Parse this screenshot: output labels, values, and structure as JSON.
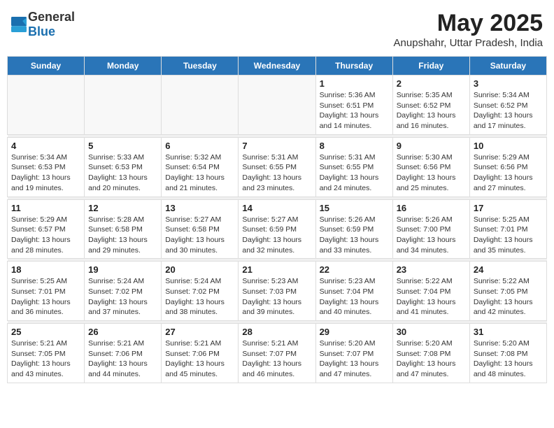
{
  "header": {
    "logo_general": "General",
    "logo_blue": "Blue",
    "month_year": "May 2025",
    "location": "Anupshahr, Uttar Pradesh, India"
  },
  "weekdays": [
    "Sunday",
    "Monday",
    "Tuesday",
    "Wednesday",
    "Thursday",
    "Friday",
    "Saturday"
  ],
  "weeks": [
    [
      {
        "day": "",
        "info": ""
      },
      {
        "day": "",
        "info": ""
      },
      {
        "day": "",
        "info": ""
      },
      {
        "day": "",
        "info": ""
      },
      {
        "day": "1",
        "info": "Sunrise: 5:36 AM\nSunset: 6:51 PM\nDaylight: 13 hours\nand 14 minutes."
      },
      {
        "day": "2",
        "info": "Sunrise: 5:35 AM\nSunset: 6:52 PM\nDaylight: 13 hours\nand 16 minutes."
      },
      {
        "day": "3",
        "info": "Sunrise: 5:34 AM\nSunset: 6:52 PM\nDaylight: 13 hours\nand 17 minutes."
      }
    ],
    [
      {
        "day": "4",
        "info": "Sunrise: 5:34 AM\nSunset: 6:53 PM\nDaylight: 13 hours\nand 19 minutes."
      },
      {
        "day": "5",
        "info": "Sunrise: 5:33 AM\nSunset: 6:53 PM\nDaylight: 13 hours\nand 20 minutes."
      },
      {
        "day": "6",
        "info": "Sunrise: 5:32 AM\nSunset: 6:54 PM\nDaylight: 13 hours\nand 21 minutes."
      },
      {
        "day": "7",
        "info": "Sunrise: 5:31 AM\nSunset: 6:55 PM\nDaylight: 13 hours\nand 23 minutes."
      },
      {
        "day": "8",
        "info": "Sunrise: 5:31 AM\nSunset: 6:55 PM\nDaylight: 13 hours\nand 24 minutes."
      },
      {
        "day": "9",
        "info": "Sunrise: 5:30 AM\nSunset: 6:56 PM\nDaylight: 13 hours\nand 25 minutes."
      },
      {
        "day": "10",
        "info": "Sunrise: 5:29 AM\nSunset: 6:56 PM\nDaylight: 13 hours\nand 27 minutes."
      }
    ],
    [
      {
        "day": "11",
        "info": "Sunrise: 5:29 AM\nSunset: 6:57 PM\nDaylight: 13 hours\nand 28 minutes."
      },
      {
        "day": "12",
        "info": "Sunrise: 5:28 AM\nSunset: 6:58 PM\nDaylight: 13 hours\nand 29 minutes."
      },
      {
        "day": "13",
        "info": "Sunrise: 5:27 AM\nSunset: 6:58 PM\nDaylight: 13 hours\nand 30 minutes."
      },
      {
        "day": "14",
        "info": "Sunrise: 5:27 AM\nSunset: 6:59 PM\nDaylight: 13 hours\nand 32 minutes."
      },
      {
        "day": "15",
        "info": "Sunrise: 5:26 AM\nSunset: 6:59 PM\nDaylight: 13 hours\nand 33 minutes."
      },
      {
        "day": "16",
        "info": "Sunrise: 5:26 AM\nSunset: 7:00 PM\nDaylight: 13 hours\nand 34 minutes."
      },
      {
        "day": "17",
        "info": "Sunrise: 5:25 AM\nSunset: 7:01 PM\nDaylight: 13 hours\nand 35 minutes."
      }
    ],
    [
      {
        "day": "18",
        "info": "Sunrise: 5:25 AM\nSunset: 7:01 PM\nDaylight: 13 hours\nand 36 minutes."
      },
      {
        "day": "19",
        "info": "Sunrise: 5:24 AM\nSunset: 7:02 PM\nDaylight: 13 hours\nand 37 minutes."
      },
      {
        "day": "20",
        "info": "Sunrise: 5:24 AM\nSunset: 7:02 PM\nDaylight: 13 hours\nand 38 minutes."
      },
      {
        "day": "21",
        "info": "Sunrise: 5:23 AM\nSunset: 7:03 PM\nDaylight: 13 hours\nand 39 minutes."
      },
      {
        "day": "22",
        "info": "Sunrise: 5:23 AM\nSunset: 7:04 PM\nDaylight: 13 hours\nand 40 minutes."
      },
      {
        "day": "23",
        "info": "Sunrise: 5:22 AM\nSunset: 7:04 PM\nDaylight: 13 hours\nand 41 minutes."
      },
      {
        "day": "24",
        "info": "Sunrise: 5:22 AM\nSunset: 7:05 PM\nDaylight: 13 hours\nand 42 minutes."
      }
    ],
    [
      {
        "day": "25",
        "info": "Sunrise: 5:21 AM\nSunset: 7:05 PM\nDaylight: 13 hours\nand 43 minutes."
      },
      {
        "day": "26",
        "info": "Sunrise: 5:21 AM\nSunset: 7:06 PM\nDaylight: 13 hours\nand 44 minutes."
      },
      {
        "day": "27",
        "info": "Sunrise: 5:21 AM\nSunset: 7:06 PM\nDaylight: 13 hours\nand 45 minutes."
      },
      {
        "day": "28",
        "info": "Sunrise: 5:21 AM\nSunset: 7:07 PM\nDaylight: 13 hours\nand 46 minutes."
      },
      {
        "day": "29",
        "info": "Sunrise: 5:20 AM\nSunset: 7:07 PM\nDaylight: 13 hours\nand 47 minutes."
      },
      {
        "day": "30",
        "info": "Sunrise: 5:20 AM\nSunset: 7:08 PM\nDaylight: 13 hours\nand 47 minutes."
      },
      {
        "day": "31",
        "info": "Sunrise: 5:20 AM\nSunset: 7:08 PM\nDaylight: 13 hours\nand 48 minutes."
      }
    ]
  ]
}
